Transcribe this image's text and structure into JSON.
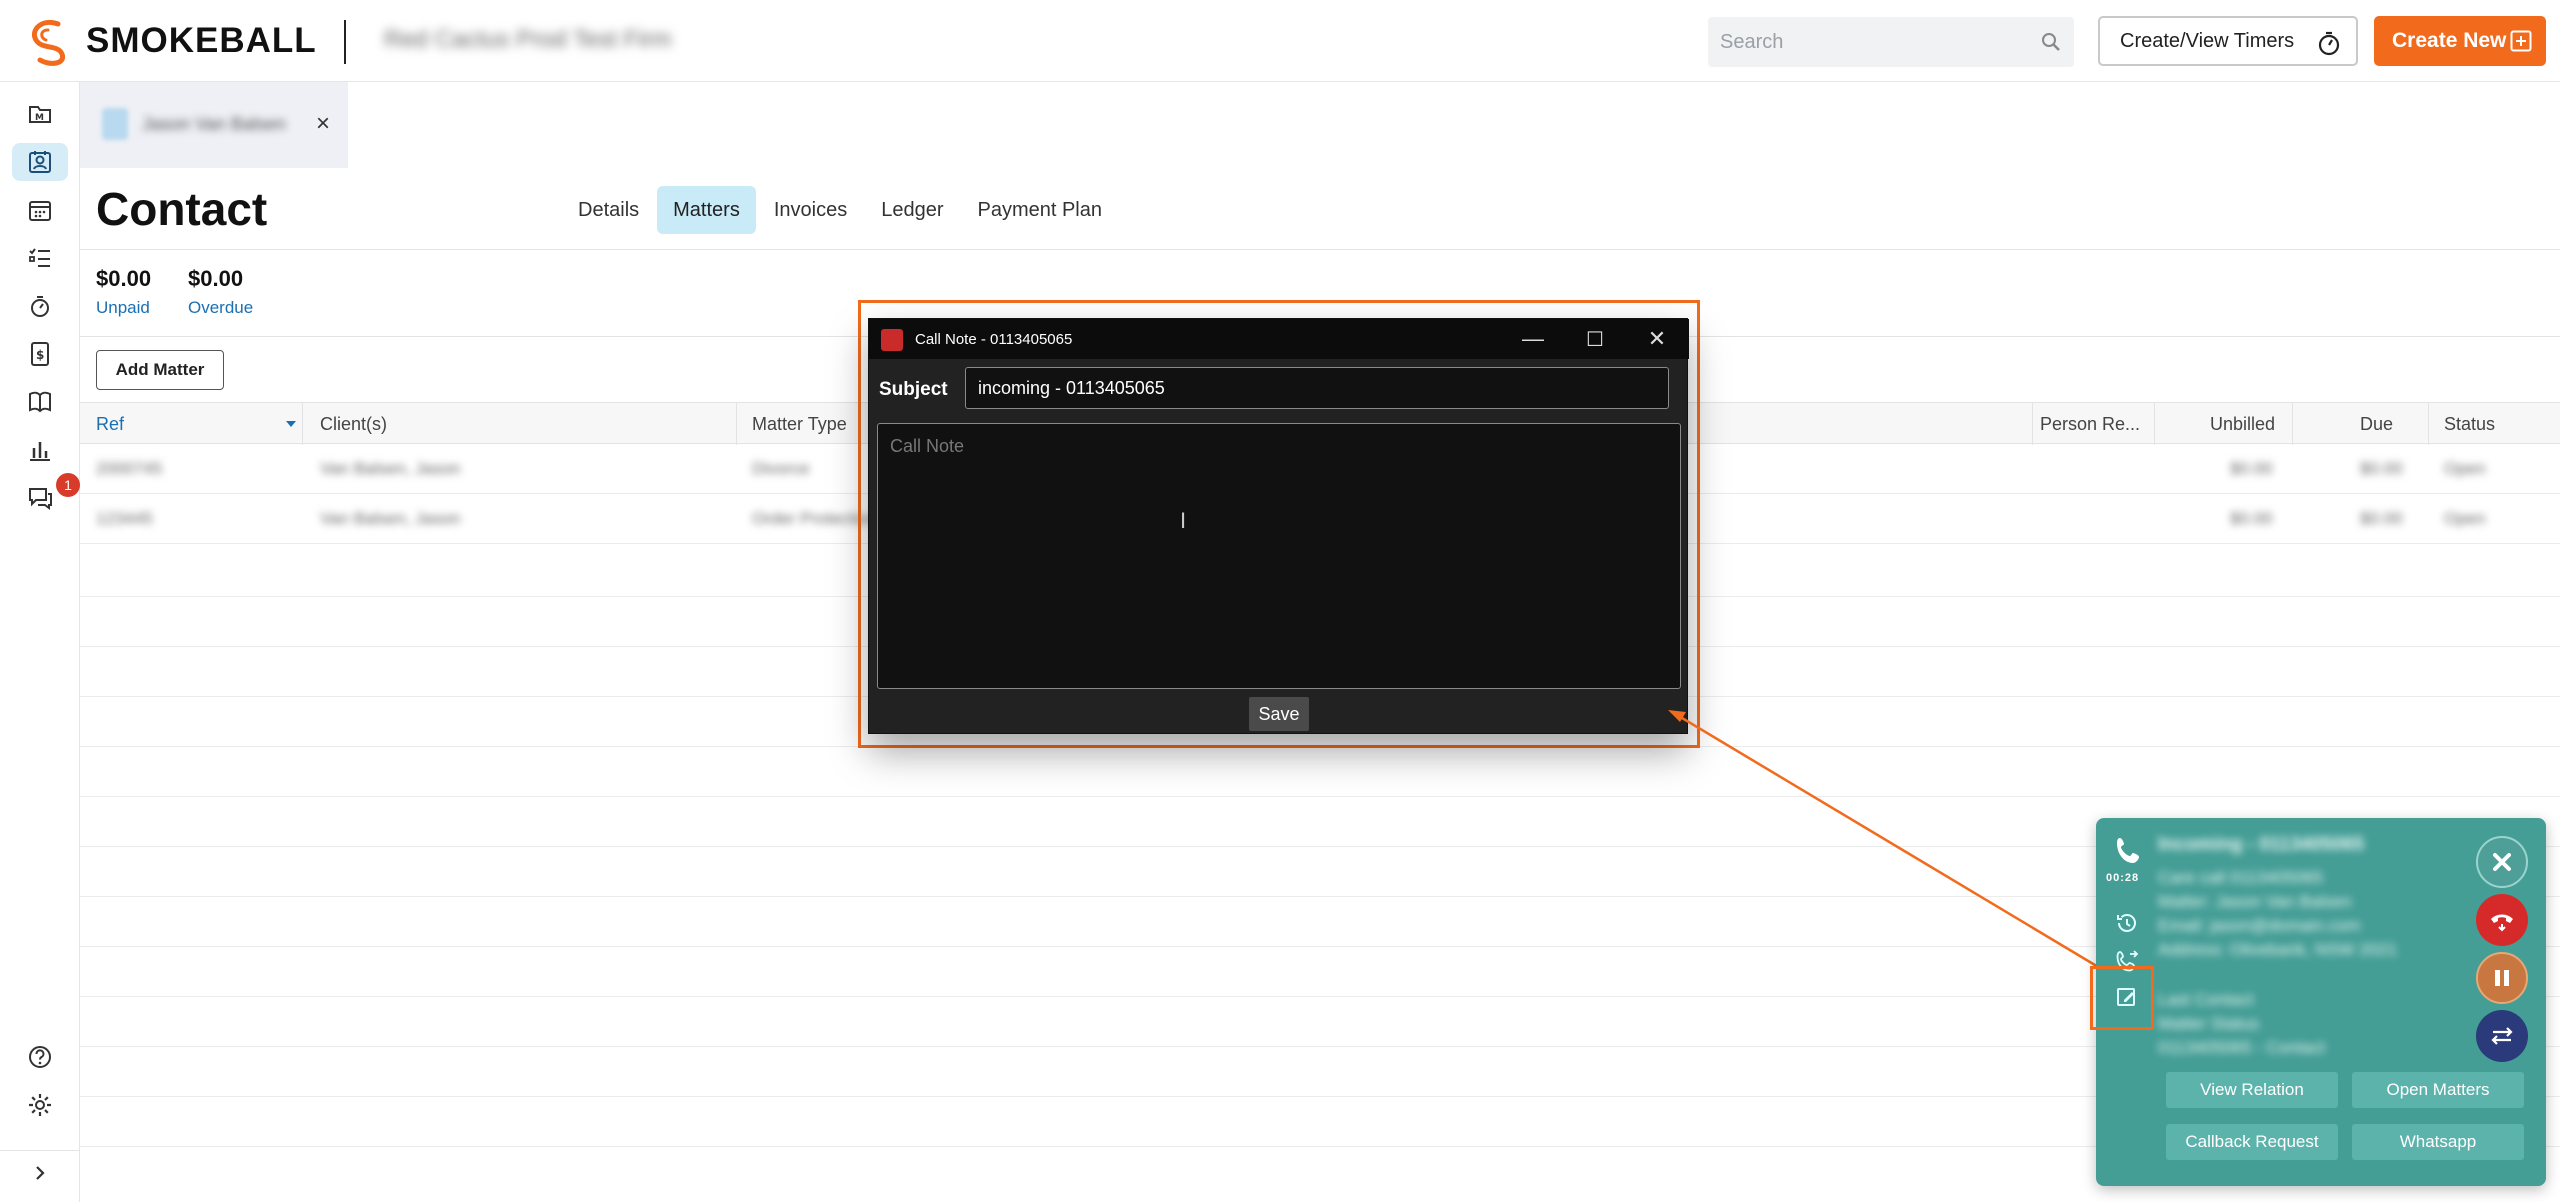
{
  "app": {
    "brand": "SMOKEBALL",
    "firm_name": "Red Cactus Prod Test Firm"
  },
  "topbar": {
    "search_placeholder": "Search",
    "timers_label": "Create/View Timers",
    "create_label": "Create New"
  },
  "nav": {
    "items": [
      "matters-icon",
      "contacts-icon",
      "calendar-icon",
      "tasks-icon",
      "timer-icon",
      "billing-icon",
      "library-icon",
      "reports-icon",
      "communicate-icon",
      "help-icon",
      "settings-icon",
      "expand-icon"
    ],
    "communicate_badge": "1"
  },
  "tab": {
    "name": "Jason Van Balsen",
    "close": "×"
  },
  "page": {
    "title": "Contact",
    "subtabs": [
      "Details",
      "Matters",
      "Invoices",
      "Ledger",
      "Payment Plan"
    ],
    "active_subtab": "Matters",
    "unpaid_amount": "$0.00",
    "unpaid_label": "Unpaid",
    "overdue_amount": "$0.00",
    "overdue_label": "Overdue",
    "add_matter_label": "Add Matter"
  },
  "table": {
    "columns": [
      "Ref",
      "Client(s)",
      "Matter Type",
      "Person Re...",
      "Unbilled",
      "Due",
      "Status"
    ],
    "rows": [
      [
        "2000745",
        "Van Balsen, Jason",
        "Divorce",
        "$0.00",
        "$0.00",
        "Open"
      ],
      [
        "123445",
        "Van Balsen, Jason",
        "Order Protection",
        "$0.00",
        "$0.00",
        "Open"
      ]
    ]
  },
  "dialog": {
    "title": "Call Note - 0113405065",
    "subject_label": "Subject",
    "subject_value": "incoming - 0113405065",
    "note_placeholder": "Call Note",
    "save_label": "Save",
    "minimize": "—",
    "maximize": "☐",
    "close": "✕"
  },
  "call_panel": {
    "timer": "00:28",
    "caller_title": "Incoming - 0113405065",
    "info_lines": [
      "Care call 0113405065",
      "Matter: Jason Van Balsen",
      "Email: jason@domain.com",
      "Address: Olivebank, NSW 2021"
    ],
    "info_lines_2": [
      "Last Contact",
      "Matter Status",
      "0113405065 - Contact"
    ],
    "buttons": [
      "View Relation",
      "Open Matters",
      "Callback Request",
      "Whatsapp"
    ]
  },
  "colors": {
    "accent": "#f26b1d",
    "teal": "#449e96",
    "link": "#1b6fb3"
  }
}
